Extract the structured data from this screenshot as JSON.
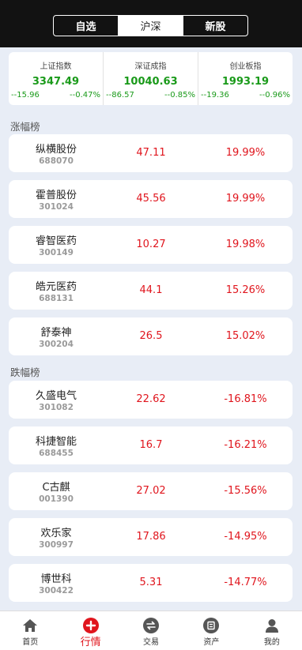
{
  "segments": [
    "自选",
    "沪深",
    "新股"
  ],
  "indices": [
    {
      "name": "上证指数",
      "value": "3347.49",
      "change": "--15.96",
      "pct": "--0.47%"
    },
    {
      "name": "深证成指",
      "value": "10040.63",
      "change": "--86.57",
      "pct": "--0.85%"
    },
    {
      "name": "创业板指",
      "value": "1993.19",
      "change": "--19.36",
      "pct": "--0.96%"
    }
  ],
  "gainers_title": "涨幅榜",
  "gainers": [
    {
      "name": "纵横股份",
      "code": "688070",
      "price": "47.11",
      "pct": "19.99%"
    },
    {
      "name": "霍普股份",
      "code": "301024",
      "price": "45.56",
      "pct": "19.99%"
    },
    {
      "name": "睿智医药",
      "code": "300149",
      "price": "10.27",
      "pct": "19.98%"
    },
    {
      "name": "皓元医药",
      "code": "688131",
      "price": "44.1",
      "pct": "15.26%"
    },
    {
      "name": "舒泰神",
      "code": "300204",
      "price": "26.5",
      "pct": "15.02%"
    }
  ],
  "losers_title": "跌幅榜",
  "losers": [
    {
      "name": "久盛电气",
      "code": "301082",
      "price": "22.62",
      "pct": "-16.81%"
    },
    {
      "name": "科捷智能",
      "code": "688455",
      "price": "16.7",
      "pct": "-16.21%"
    },
    {
      "name": "C古麒",
      "code": "001390",
      "price": "27.02",
      "pct": "-15.56%"
    },
    {
      "name": "欢乐家",
      "code": "300997",
      "price": "17.86",
      "pct": "-14.95%"
    },
    {
      "name": "博世科",
      "code": "300422",
      "price": "5.31",
      "pct": "-14.77%"
    }
  ],
  "tabbar": [
    {
      "label": "首页",
      "icon": "home-icon"
    },
    {
      "label": "行情",
      "icon": "market-icon"
    },
    {
      "label": "交易",
      "icon": "trade-icon"
    },
    {
      "label": "资产",
      "icon": "assets-icon"
    },
    {
      "label": "我的",
      "icon": "user-icon"
    }
  ],
  "colors": {
    "up": "#e0151d",
    "down": "#1a9a1a",
    "header_bg": "#121212",
    "page_bg": "#e8edf6"
  }
}
